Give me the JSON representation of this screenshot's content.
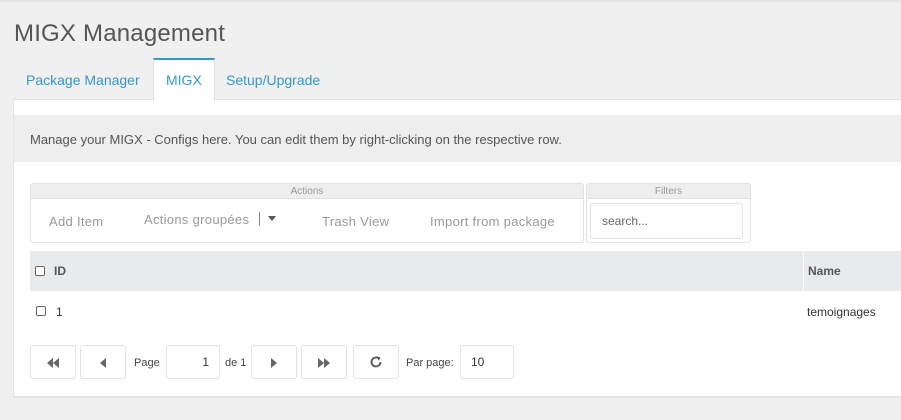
{
  "page": {
    "title": "MIGX Management"
  },
  "tabs": [
    {
      "label": "Package Manager"
    },
    {
      "label": "MIGX"
    },
    {
      "label": "Setup/Upgrade"
    }
  ],
  "description": "Manage your MIGX - Configs here. You can edit them by right-clicking on the respective row.",
  "toolbar": {
    "actions_header": "Actions",
    "filters_header": "Filters",
    "add_item": "Add Item",
    "bulk_actions": "Actions groupées",
    "trash_view": "Trash View",
    "import": "Import from package",
    "search_placeholder": "search..."
  },
  "grid": {
    "columns": {
      "id": "ID",
      "name": "Name"
    },
    "rows": [
      {
        "id": "1",
        "name": "temoignages"
      }
    ]
  },
  "pagination": {
    "page_label": "Page",
    "current_page": "1",
    "of_label": "de 1",
    "per_page_label": "Par page:",
    "per_page": "10"
  },
  "colors": {
    "accent": "#3697cd",
    "header_bg": "#e9eaec",
    "page_bg": "#f0f0f0"
  }
}
